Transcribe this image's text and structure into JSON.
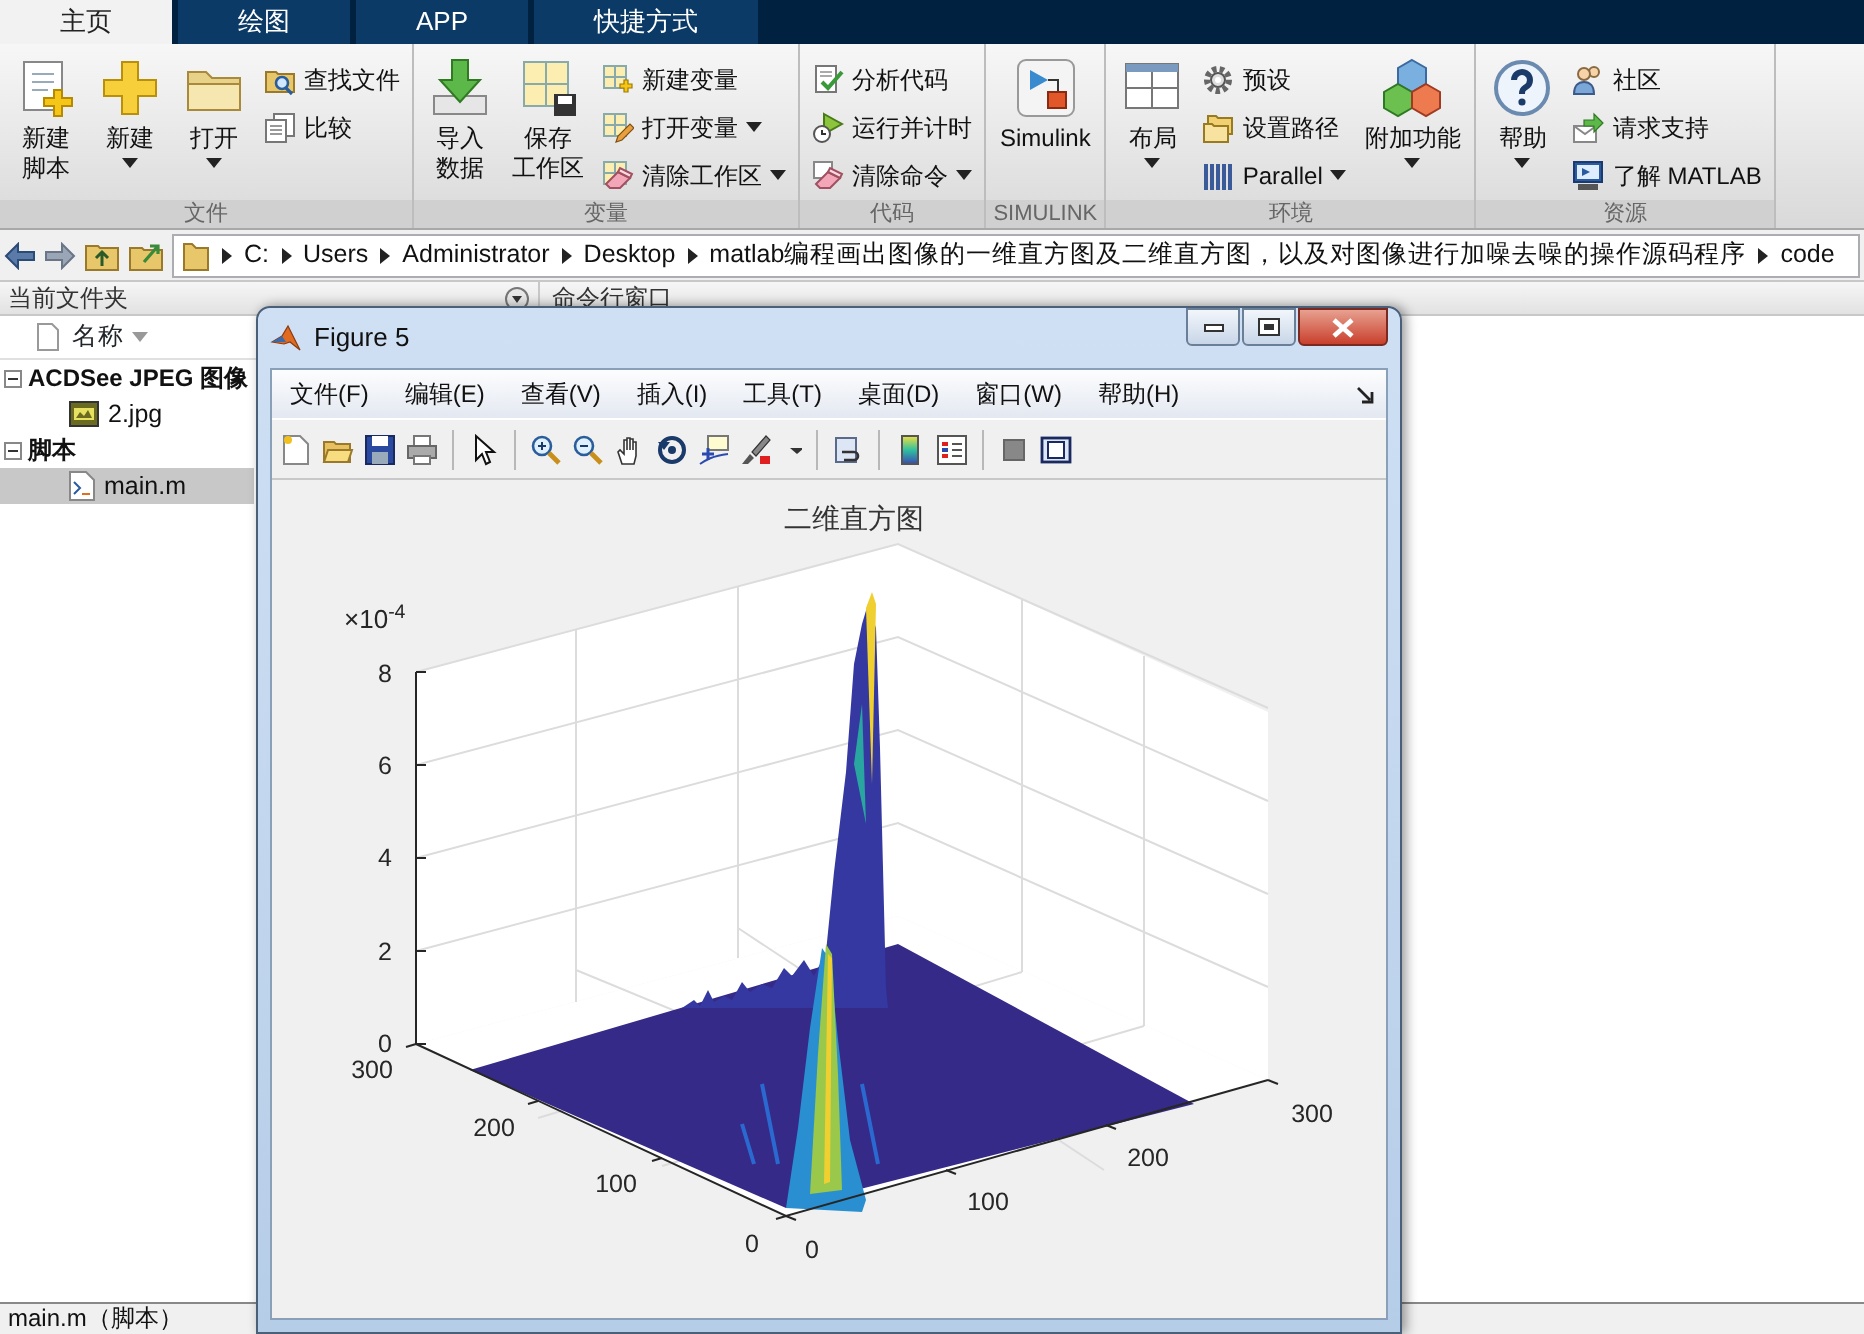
{
  "tabs": [
    {
      "label": "主页",
      "selected": true
    },
    {
      "label": "绘图",
      "selected": false
    },
    {
      "label": "APP",
      "selected": false
    },
    {
      "label": "快捷方式",
      "selected": false
    }
  ],
  "ribbon": [
    {
      "label": "文件",
      "columns": [
        {
          "kind": "large",
          "lines": [
            "新建",
            "脚本"
          ],
          "dropdown": false
        },
        {
          "kind": "large",
          "lines": [
            "新建"
          ],
          "dropdown": true
        },
        {
          "kind": "large",
          "lines": [
            "打开"
          ],
          "dropdown": true
        },
        {
          "kind": "stack",
          "items": [
            {
              "label": "查找文件",
              "dropdown": false
            },
            {
              "label": "比较",
              "dropdown": false
            }
          ]
        }
      ]
    },
    {
      "label": "变量",
      "columns": [
        {
          "kind": "large",
          "lines": [
            "导入",
            "数据"
          ],
          "dropdown": false
        },
        {
          "kind": "large",
          "lines": [
            "保存",
            "工作区"
          ],
          "dropdown": false
        },
        {
          "kind": "stack",
          "items": [
            {
              "label": "新建变量",
              "dropdown": false
            },
            {
              "label": "打开变量",
              "dropdown": true
            },
            {
              "label": "清除工作区",
              "dropdown": true
            }
          ]
        }
      ]
    },
    {
      "label": "代码",
      "columns": [
        {
          "kind": "stack",
          "items": [
            {
              "label": "分析代码",
              "dropdown": false
            },
            {
              "label": "运行并计时",
              "dropdown": false
            },
            {
              "label": "清除命令",
              "dropdown": true
            }
          ]
        }
      ]
    },
    {
      "label": "SIMULINK",
      "columns": [
        {
          "kind": "large",
          "lines": [
            "Simulink"
          ],
          "dropdown": false
        }
      ]
    },
    {
      "label": "环境",
      "columns": [
        {
          "kind": "large",
          "lines": [
            "布局"
          ],
          "dropdown": true
        },
        {
          "kind": "stack",
          "items": [
            {
              "label": "预设",
              "dropdown": false
            },
            {
              "label": "设置路径",
              "dropdown": false
            },
            {
              "label": "Parallel",
              "dropdown": true
            }
          ]
        },
        {
          "kind": "large",
          "lines": [
            "附加功能"
          ],
          "dropdown": true
        }
      ]
    },
    {
      "label": "资源",
      "columns": [
        {
          "kind": "large",
          "lines": [
            "帮助"
          ],
          "dropdown": true
        },
        {
          "kind": "stack",
          "items": [
            {
              "label": "社区",
              "dropdown": false
            },
            {
              "label": "请求支持",
              "dropdown": false
            },
            {
              "label": "了解 MATLAB",
              "dropdown": false
            }
          ]
        }
      ]
    }
  ],
  "address_bar": {
    "segments": [
      "C:",
      "Users",
      "Administrator",
      "Desktop",
      "matlab编程画出图像的一维直方图及二维直方图，以及对图像进行加噪去噪的操作源码程序",
      "code"
    ]
  },
  "panels": {
    "current_folder": "当前文件夹",
    "command_window": "命令行窗口"
  },
  "file_list": {
    "column": "名称",
    "groups": [
      {
        "label": "ACDSee JPEG 图像",
        "expanded": true,
        "children": [
          {
            "label": "2.jpg",
            "kind": "image",
            "selected": false
          }
        ]
      },
      {
        "label": "脚本",
        "expanded": true,
        "children": [
          {
            "label": "main.m",
            "kind": "script",
            "selected": true
          }
        ]
      }
    ]
  },
  "status_bar": "main.m（脚本）",
  "figure": {
    "title": "Figure 5",
    "menus": [
      "文件(F)",
      "编辑(E)",
      "查看(V)",
      "插入(I)",
      "工具(T)",
      "桌面(D)",
      "窗口(W)",
      "帮助(H)"
    ],
    "plot": {
      "title": "二维直方图",
      "z_exponent": "×10$^{-4}$",
      "z_ticks": [
        "8",
        "6",
        "4",
        "2",
        "0"
      ],
      "y_ticks": [
        "300",
        "200",
        "100",
        "0"
      ],
      "x_ticks": [
        "0",
        "100",
        "200",
        "300"
      ]
    }
  }
}
